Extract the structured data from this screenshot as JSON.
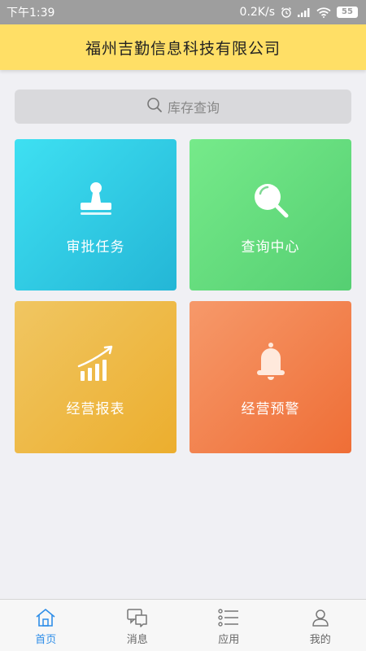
{
  "status_bar": {
    "time": "下午1:39",
    "speed": "0.2K/s",
    "battery": "55",
    "icons": [
      "alarm-icon",
      "signal-icon",
      "wifi-icon",
      "battery-icon"
    ]
  },
  "header": {
    "title": "福州吉勤信息科技有限公司"
  },
  "search": {
    "placeholder": "库存查询",
    "icon": "search-icon"
  },
  "tiles": [
    {
      "label": "审批任务",
      "icon": "stamp-icon",
      "color_start": "#3ee0f2",
      "color_end": "#24b6d6"
    },
    {
      "label": "查询中心",
      "icon": "magnifier-icon",
      "color_start": "#76ea8a",
      "color_end": "#55cf72"
    },
    {
      "label": "经营报表",
      "icon": "growth-chart-icon",
      "color_start": "#f0c662",
      "color_end": "#ecae2e"
    },
    {
      "label": "经营预警",
      "icon": "bell-icon",
      "color_start": "#f6996a",
      "color_end": "#ef6e36"
    }
  ],
  "bottom_nav": {
    "active_color": "#2f8ee8",
    "items": [
      {
        "label": "首页",
        "icon": "home-icon",
        "active": true
      },
      {
        "label": "消息",
        "icon": "message-icon",
        "active": false
      },
      {
        "label": "应用",
        "icon": "list-icon",
        "active": false
      },
      {
        "label": "我的",
        "icon": "user-icon",
        "active": false
      }
    ]
  }
}
